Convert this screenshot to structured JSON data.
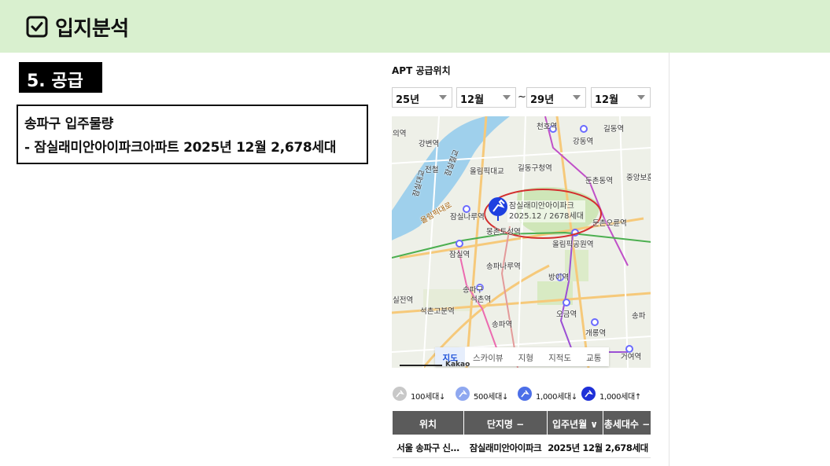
{
  "header": {
    "title": "입지분석",
    "icon": "checkbox-icon",
    "bg_color": "#d9f0cf"
  },
  "section": {
    "tag": "5. 공급"
  },
  "info": {
    "line1": "송파구 입주물량",
    "line2": "- 잠실래미안아이파크아파트 2025년 12월 2,678세대"
  },
  "panel": {
    "title": "APT 공급위치",
    "from_year": "25년",
    "from_month": "12월",
    "separator": "~",
    "to_year": "29년",
    "to_month": "12월"
  },
  "map": {
    "labels": [
      "천호역",
      "길동역",
      "강동역",
      "강변역",
      "올림픽대교",
      "길동구청역",
      "둔촌동역",
      "중앙보훈",
      "잠실나루역",
      "잠실역",
      "둔촌오륜역",
      "몽촌토성역",
      "올림픽공원역",
      "송파나루역",
      "방이역",
      "송파구",
      "석촌역",
      "석촌고분역",
      "오금역",
      "송파역",
      "개롱역",
      "거여역",
      "송파",
      "의역",
      "실전역",
      "잠실대교",
      "올림픽대로",
      "잠실철교",
      "전철"
    ],
    "callout_name": "잠실래미안아이파크",
    "callout_detail": "2025.12 / 2678세대",
    "highlight_color": "#d32f2f",
    "pin_color": "#1e40e0",
    "tabs": [
      "지도",
      "스카이뷰",
      "지형",
      "지적도",
      "교통"
    ],
    "active_tab": "지도",
    "attribution": "Kakao"
  },
  "legend": [
    {
      "label": "100세대↓",
      "color": "#c8c8c8"
    },
    {
      "label": "500세대↓",
      "color": "#8fa8f0"
    },
    {
      "label": "1,000세대↓",
      "color": "#4c6fe8"
    },
    {
      "label": "1,000세대↑",
      "color": "#1e30d8"
    }
  ],
  "table": {
    "headers": [
      "위치",
      "단지명 −",
      "입주년월 ∨",
      "총세대수 −"
    ],
    "rows": [
      [
        "서울 송파구 신…",
        "잠실래미안아이파크",
        "2025년 12월",
        "2,678세대"
      ]
    ]
  }
}
